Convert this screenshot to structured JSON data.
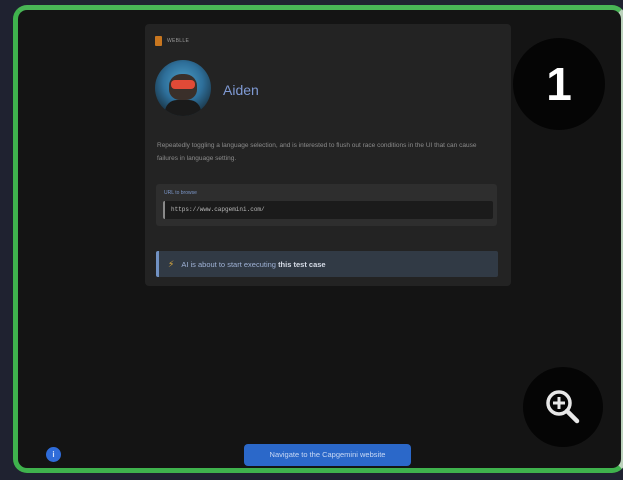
{
  "brand": {
    "name": "WEBLLE",
    "logo_color": "#c8761f"
  },
  "user": {
    "name": "Aiden"
  },
  "task": {
    "description": "Repeatedly toggling a language selection, and is interested to flush out race conditions in the UI that can cause failures in language setting.",
    "url_label": "URL to browse",
    "url_value": "https://www.capgemini.com/"
  },
  "status": {
    "prefix": "AI is about to start executing ",
    "emphasis": "this test case",
    "icon": "lightning-icon"
  },
  "step": {
    "number": "1"
  },
  "actions": {
    "navigate_label": "Navigate to the Capgemini website",
    "info_label": "i",
    "zoom_icon": "zoom-in-icon"
  },
  "colors": {
    "frame_border": "#3fb24d",
    "accent": "#2b68c9",
    "name_text": "#7f9ad4"
  }
}
